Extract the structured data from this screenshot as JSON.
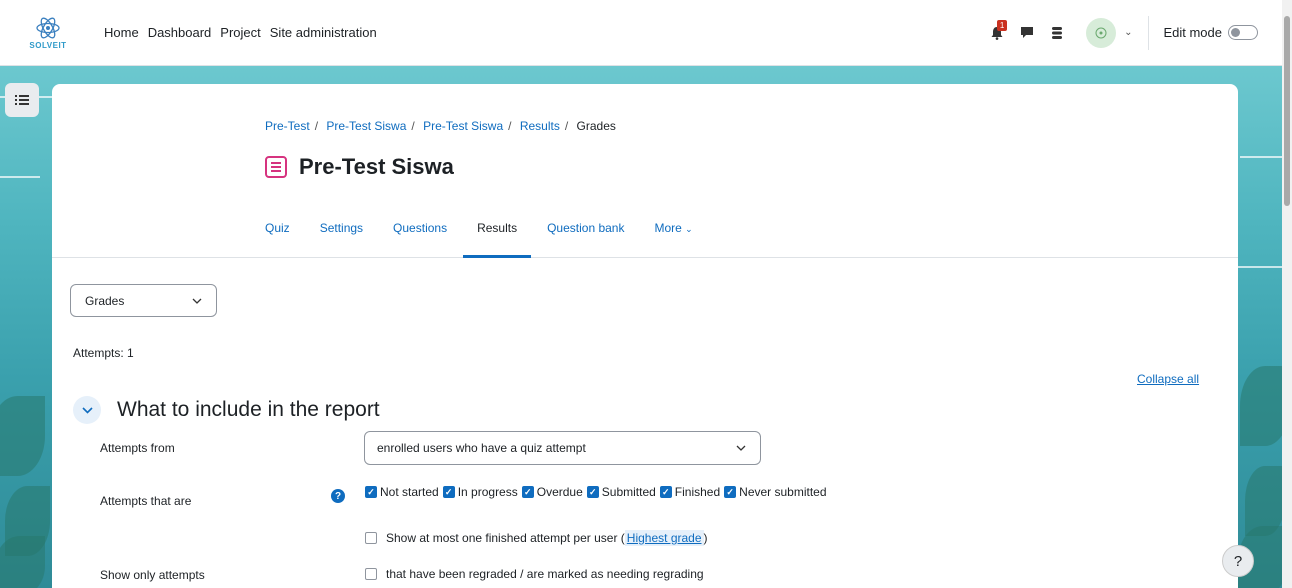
{
  "brand": {
    "logo_text": "SOLVEIT"
  },
  "nav": {
    "items": [
      "Home",
      "Dashboard",
      "Project",
      "Site administration"
    ]
  },
  "user_menu": {
    "notifications_count": "1",
    "edit_mode_label": "Edit mode"
  },
  "breadcrumb": [
    "Pre-Test",
    "Pre-Test Siswa",
    "Pre-Test Siswa",
    "Results",
    "Grades"
  ],
  "page": {
    "title": "Pre-Test Siswa"
  },
  "tabs": [
    "Quiz",
    "Settings",
    "Questions",
    "Results",
    "Question bank",
    "More"
  ],
  "active_tab": "Results",
  "report": {
    "selected": "Grades",
    "attempts_text": "Attempts: 1",
    "collapse_all": "Collapse all"
  },
  "section": {
    "title": "What to include in the report",
    "attempts_from_label": "Attempts from",
    "attempts_from_value": "enrolled users who have a quiz attempt",
    "attempts_that_are_label": "Attempts that are",
    "states": [
      {
        "label": "Not started",
        "checked": true
      },
      {
        "label": "In progress",
        "checked": true
      },
      {
        "label": "Overdue",
        "checked": true
      },
      {
        "label": "Submitted",
        "checked": true
      },
      {
        "label": "Finished",
        "checked": true
      },
      {
        "label": "Never submitted",
        "checked": true
      }
    ],
    "one_attempt_text": "Show at most one finished attempt per user (",
    "one_attempt_link": "Highest grade",
    "one_attempt_close": ")",
    "show_only_label": "Show only attempts",
    "regraded_text": "that have been regraded / are marked as needing regrading"
  },
  "help_fab": "?",
  "colors": {
    "primary": "#0f6cbf",
    "quiz_icon": "#d6337f",
    "notification": "#ca3120"
  }
}
